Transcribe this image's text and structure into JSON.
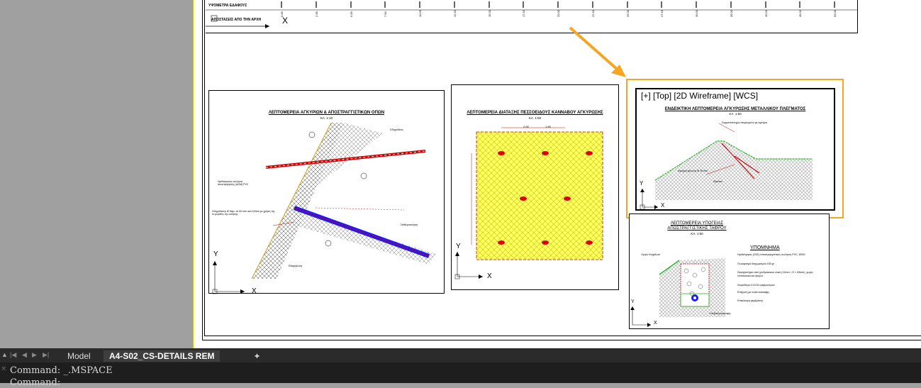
{
  "layout_tabs": {
    "model_label": "Model",
    "active_label": "A4-S02_CS-DETAILS REM",
    "add_label": "+"
  },
  "command": {
    "line1": "Command:  _.MSPACE",
    "line2": "Command:"
  },
  "top_strip": {
    "row1": "ΥΨΟΜΕΤΡΑ ΕΔΑΦΟΥΣ",
    "row2": "ΑΠΟΣΤΑΣΕΙΣ ΑΠΟ ΤΗΝ ΑΡΧΗ",
    "ticks": [
      "0.00",
      "2.00",
      "5.00",
      "7.50",
      "10.00",
      "12.50",
      "15.00",
      "17.50",
      "20.00",
      "22.50",
      "25.00",
      "27.50",
      "30.00",
      "35.00",
      "40.00",
      "45.00",
      "50.00"
    ]
  },
  "viewport1": {
    "title": "ΛΕΠΤΟΜΕΡΕΙΑ ΑΓΚΥΡΙΩΝ & ΑΠΟΣΤΡΑΓΓΙΣΤΙΚΩΝ ΟΠΩΝ",
    "scale": "ΚΛ. 1:10",
    "note1": "Ημιδιάτρητος σωλήνας αποστράγγισης (ΔΟΜ) PVC",
    "note2": "Σιδηρόδεσης Ø διάμ. σε 60 mm ανά 100cm με χρήση της το μέγεθος της ανάγκης",
    "note3": "Σιδηροδέτες",
    "note4": "Εδαφήλωση",
    "note5": "Σταθεροποίηση"
  },
  "viewport2": {
    "title": "ΛΕΠΤΟΜΕΡΕΙΑ ΔΙΑΤΑΞΗΣ ΠΕΣΣΟΕΙΔΟΥΣ ΚΑΝΝΑΒΟΥ ΑΓΚΥΡΩΣΗΣ",
    "scale": "ΚΛ. 1:50",
    "dim1": "2.00",
    "dim2": "1.50"
  },
  "viewport3": {
    "label": "[+] [Top] [2D Wireframe] [WCS]",
    "title": "ΕΝΔΕΙΚΤΙΚΗ ΛΕΠΤΟΜΕΡΕΙΑ ΑΓΚΥΡΩΣΗΣ ΜΕΤΑΛΛΙΚΟΥ ΠΛΕΓΜΑΤΟΣ",
    "scale": "ΚΛ. 1:50",
    "note1": "Συρματόπλεγμα στερεωμένο με αγκύρια",
    "note2": "Αγκύρια ήλωσης Ø 16 mm",
    "note3": "Φρεάτιο"
  },
  "viewport4": {
    "title_line1": "ΛΕΠΤΟΜΕΡΕΙΑ ΥΠΟΓΕΙΑΣ",
    "title_line2": "ΑΠΟΣΤΡΑΓΓΙΣΤΙΚΗΣ ΤΑΦΡΟΥ",
    "scale": "ΚΛ. 1:50",
    "legend_title": "ΥΠΟΜΝΗΜΑ",
    "legend1": "Ημιδιάτρητος (ΣΩΣ) αποστραγγιστικός σωλήνας PVC, Ø200",
    "legend2": "Γεωύφασμα διαχωρισμού 150 gr",
    "legend3": "Στραγγιστήριο από χονδρόκοκκο υλικό (12mm < D < 63mm), χωρίς λεπτόκοκκα και άργιλο",
    "legend4": "Σκυρόδεμα C12/15 εγκιβωτισμού",
    "legend5": "Επίχωση με υλικά εκσκαφής",
    "legend6": "Επικάλυψη μεμβράνης",
    "note1": "Υψηλό Ψηφιδωτό",
    "note2": "Υπόβαση εκσκαφής"
  },
  "axes": {
    "x": "X",
    "y": "Y"
  }
}
